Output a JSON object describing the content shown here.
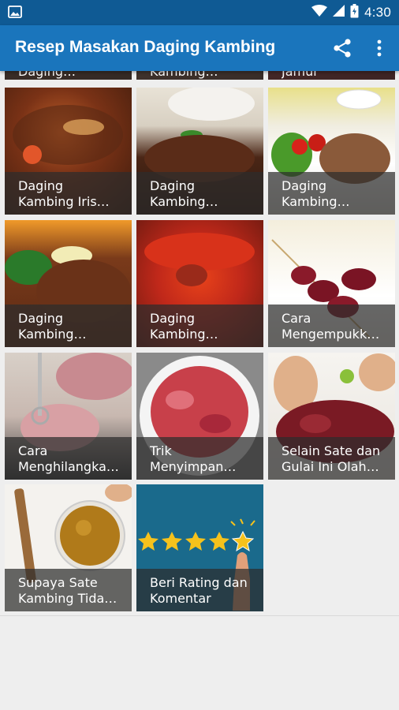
{
  "status_bar": {
    "time": "4:30"
  },
  "app_bar": {
    "title": "Resep Masakan Daging Kambing",
    "share_icon": "share-icon",
    "more_icon": "more-vert-icon"
  },
  "partial_row": [
    {
      "line1": "Daging…"
    },
    {
      "line1": "Kambing…"
    },
    {
      "line1": "Jamur"
    }
  ],
  "tiles": [
    {
      "line1": "Daging",
      "line2": "Kambing Iris…"
    },
    {
      "line1": "Daging",
      "line2": "Kambing…"
    },
    {
      "line1": "Daging",
      "line2": "Kambing…"
    },
    {
      "line1": "Daging",
      "line2": "Kambing…"
    },
    {
      "line1": "Daging",
      "line2": "Kambing…"
    },
    {
      "line1": "Cara",
      "line2": "Mengempukk…"
    },
    {
      "line1": "Cara",
      "line2": "Menghilangka…"
    },
    {
      "line1": "Trik",
      "line2": "Menyimpan…"
    },
    {
      "line1": "Selain Sate dan",
      "line2": "Gulai Ini Olah…"
    },
    {
      "line1": "Supaya Sate",
      "line2": "Kambing Tida…"
    },
    {
      "line1": "Beri Rating dan",
      "line2": "Komentar"
    }
  ],
  "colors": {
    "status_bar": "#0f5a94",
    "app_bar": "#1a75bc",
    "rating_tile": "#1a6a8c",
    "star": "#f6c21c"
  }
}
